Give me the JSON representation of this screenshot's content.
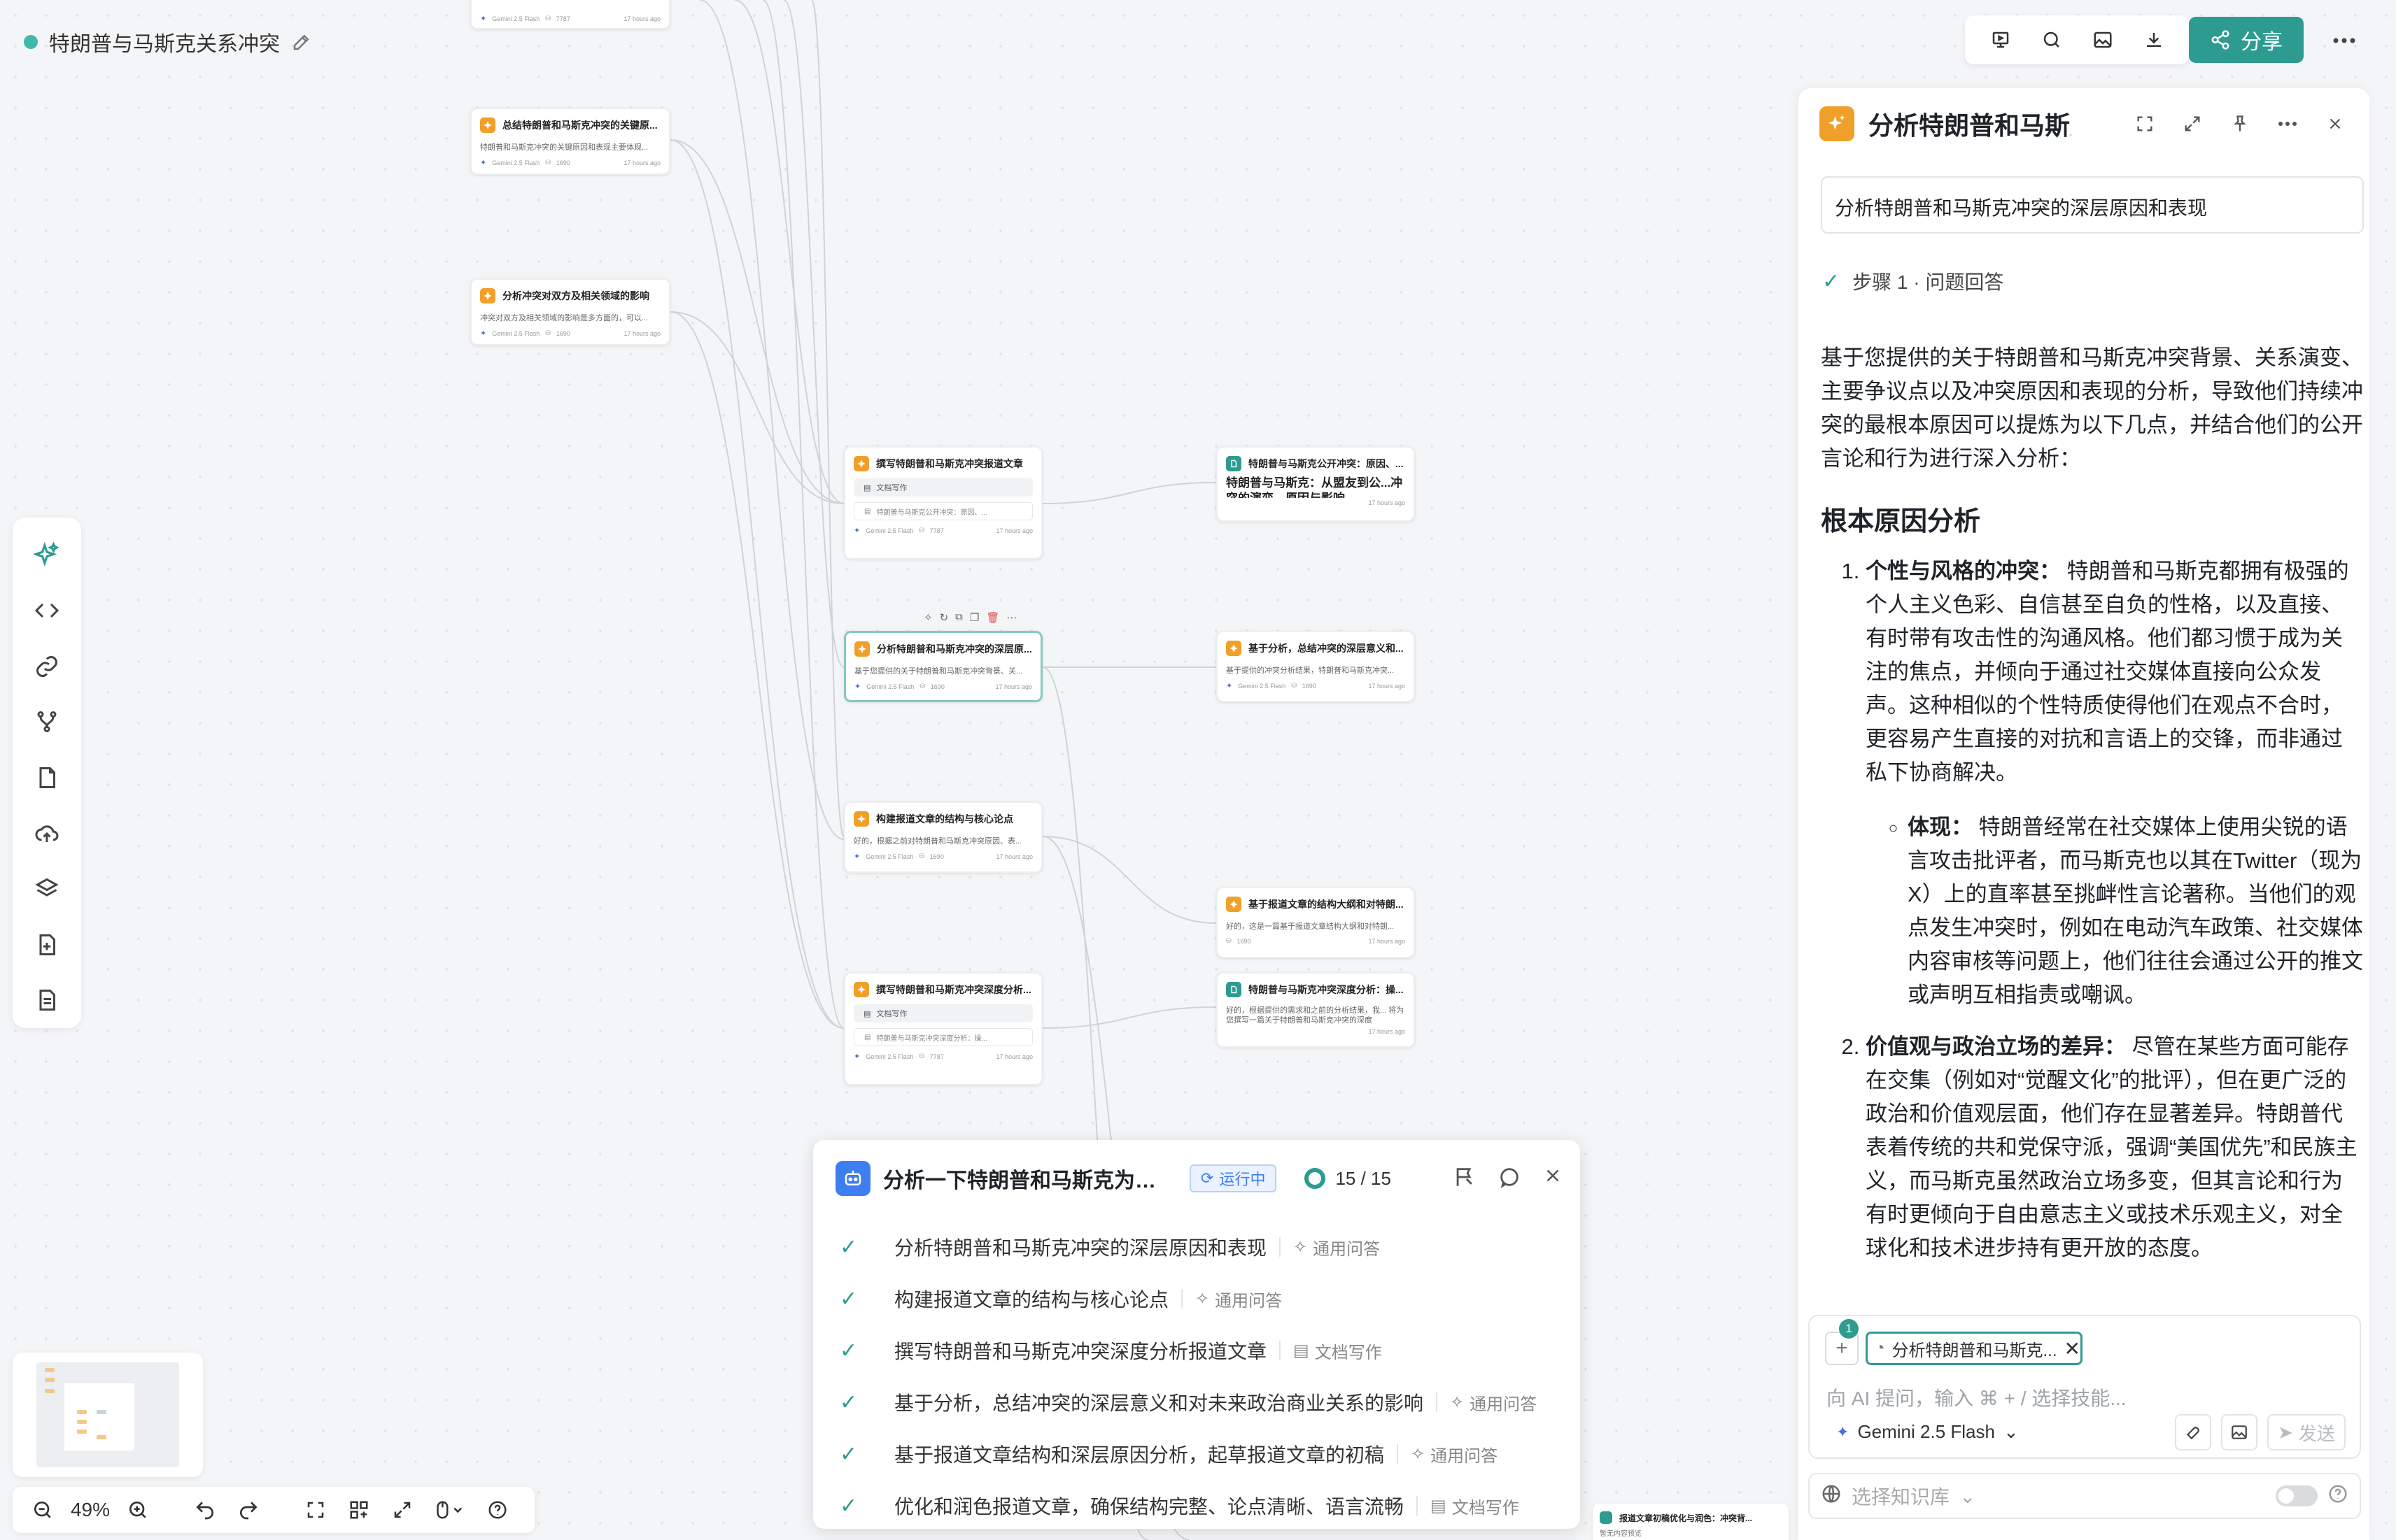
{
  "header": {
    "title": "特朗普与马斯克关系冲突",
    "share_label": "分享"
  },
  "nodes": [
    {
      "title": "",
      "body": "",
      "model": "Gemini 2.5 Flash",
      "tokens": "7787",
      "time": "17 hours ago"
    },
    {
      "title": "总结特朗普和马斯克冲突的关键原...",
      "body": "特朗普和马斯克冲突的关键原因和表现主要体现...",
      "model": "Gemini 2.5 Flash",
      "tokens": "1690",
      "time": "17 hours ago"
    },
    {
      "title": "分析冲突对双方及相关领域的影响",
      "body": "冲突对双方及相关领域的影响是多方面的，可以...",
      "model": "Gemini 2.5 Flash",
      "tokens": "1690",
      "time": "17 hours ago"
    },
    {
      "title": "撰写特朗普和马斯克冲突报道文章",
      "tag": "文档写作",
      "ref": "特朗普与马斯克公开冲突：原因、...",
      "model": "Gemini 2.5 Flash",
      "tokens": "7787",
      "time": "17 hours ago"
    },
    {
      "title": "特朗普与马斯克公开冲突：原因、...",
      "body": "特朗普与马斯克：从盟友到公...冲突的演变、原因与影响",
      "time": "17 hours ago"
    },
    {
      "title": "分析特朗普和马斯克冲突的深层原...",
      "body": "基于您提供的关于特朗普和马斯克冲突背景、关...",
      "model": "Gemini 2.5 Flash",
      "tokens": "1690",
      "time": "17 hours ago"
    },
    {
      "title": "基于分析，总结冲突的深层意义和...",
      "body": "基于提供的冲突分析结果，特朗普和马斯克冲突...",
      "model": "Gemini 2.5 Flash",
      "tokens": "1690",
      "time": "17 hours ago"
    },
    {
      "title": "构建报道文章的结构与核心论点",
      "body": "好的，根据之前对特朗普和马斯克冲突原因、表...",
      "model": "Gemini 2.5 Flash",
      "tokens": "1690",
      "time": "17 hours ago"
    },
    {
      "title": "基于报道文章的结构大纲和对特朗...",
      "body": "好的，这是一篇基于报道文章结构大纲和对特朗...",
      "tokens": "1690",
      "time": "17 hours ago"
    },
    {
      "title": "撰写特朗普和马斯克冲突深度分析...",
      "tag": "文档写作",
      "ref": "特朗普与马斯克冲突深度分析：操...",
      "model": "Gemini 2.5 Flash",
      "tokens": "7787",
      "time": "17 hours ago"
    },
    {
      "title": "特朗普与马斯克冲突深度分析：操...",
      "body": "好的，根据提供的需求和之前的分析结果，我... 将为您撰写一篇关于特朗普和马斯克冲突的深度",
      "time": "17 hours ago"
    }
  ],
  "bottom_node": {
    "title": "报道文章初稿优化与润色：冲突背...",
    "sub": "暂无内容预览"
  },
  "zoom": {
    "value": "49%"
  },
  "panel": {
    "title": "分析特朗普和马斯克...",
    "query": "分析特朗普和马斯克冲突的深层原因和表现",
    "step": "步骤 1 · 问题回答",
    "intro": "基于您提供的关于特朗普和马斯克冲突背景、关系演变、主要争议点以及冲突原因和表现的分析，导致他们持续冲突的最根本原因可以提炼为以下几点，并结合他们的公开言论和行为进行深入分析：",
    "h2": "根本原因分析",
    "items": [
      {
        "label": "个性与风格的冲突：",
        "text": "特朗普和马斯克都拥有极强的个人主义色彩、自信甚至自负的性格，以及直接、有时带有攻击性的沟通风格。他们都习惯于成为关注的焦点，并倾向于通过社交媒体直接向公众发声。这种相似的个性特质使得他们在观点不合时，更容易产生直接的对抗和言语上的交锋，而非通过私下协商解决。",
        "sub_label": "体现：",
        "sub_text": "特朗普经常在社交媒体上使用尖锐的语言攻击批评者，而马斯克也以其在Twitter（现为X）上的直率甚至挑衅性言论著称。当他们的观点发生冲突时，例如在电动汽车政策、社交媒体内容审核等问题上，他们往往会通过公开的推文或声明互相指责或嘲讽。"
      },
      {
        "label": "价值观与政治立场的差异：",
        "text": "尽管在某些方面可能存在交集（例如对“觉醒文化”的批评），但在更广泛的政治和价值观层面，他们存在显著差异。特朗普代表着传统的共和党保守派，强调“美国优先”和民族主义，而马斯克虽然政治立场多变，但其言论和行为有时更倾向于自由意志主义或技术乐观主义，对全球化和技术进步持有更开放的态度。"
      }
    ],
    "chat": {
      "badge": "1",
      "chip": "分析特朗普和马斯克...",
      "placeholder": "向 AI 提问，输入 ⌘ + / 选择技能...",
      "model": "Gemini 2.5 Flash",
      "send": "发送"
    },
    "kb_placeholder": "选择知识库"
  },
  "task": {
    "title": "分析一下特朗普和马斯克为什么...",
    "status": "运行中",
    "progress": "15 / 15",
    "items": [
      {
        "name": "分析特朗普和马斯克冲突的深层原因和表现",
        "type": "通用问答"
      },
      {
        "name": "构建报道文章的结构与核心论点",
        "type": "通用问答"
      },
      {
        "name": "撰写特朗普和马斯克冲突深度分析报道文章",
        "type": "文档写作"
      },
      {
        "name": "基于分析，总结冲突的深层意义和对未来政治商业关系的影响",
        "type": "通用问答"
      },
      {
        "name": "基于报道文章结构和深层原因分析，起草报道文章的初稿",
        "type": "通用问答"
      },
      {
        "name": "优化和润色报道文章，确保结构完整、论点清晰、语言流畅",
        "type": "文档写作"
      }
    ]
  },
  "colors": {
    "accent": "#2d9b8f",
    "node_icon": "#f0a02a",
    "task_icon": "#3d7ef0"
  }
}
